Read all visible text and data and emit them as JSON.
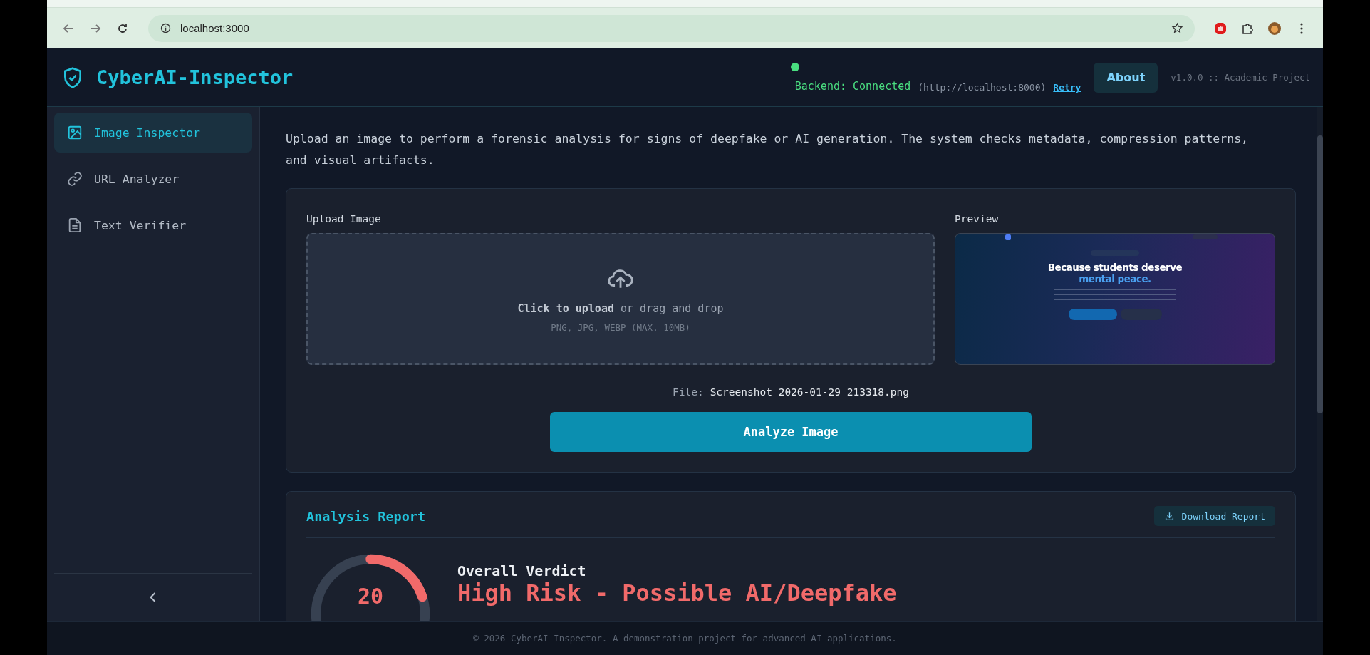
{
  "browser": {
    "address": "localhost:3000"
  },
  "app": {
    "title": "CyberAI-Inspector"
  },
  "status": {
    "label": "Backend: Connected",
    "connected": true,
    "url": "(http://localhost:8000)",
    "retry": "Retry"
  },
  "header_button": "About",
  "version": "v1.0.0 :: Academic Project",
  "sidebar": {
    "items": [
      {
        "label": "Image Inspector",
        "selected": true
      },
      {
        "label": "URL Analyzer",
        "selected": false
      },
      {
        "label": "Text Verifier",
        "selected": false
      }
    ]
  },
  "description": "Upload an image to perform a forensic analysis for signs of deepfake or AI generation. The system checks metadata, compression patterns, and visual artifacts.",
  "upload": {
    "label": "Upload Image",
    "prompt": "**Click to upload** or drag and drop",
    "hint": "PNG, JPG, WEBP (MAX. 10MB)"
  },
  "preview": {
    "label": "Preview",
    "headline": "Because students deserve",
    "highlight": "mental peace."
  },
  "file": {
    "label": "File:",
    "name": "Screenshot 2026-01-29 213318.png"
  },
  "analyze_button": "Analyze Image",
  "report": {
    "title": "Analysis Report",
    "download": "Download Report",
    "score": "20",
    "level": 0.2,
    "verdict_label": "Overall Verdict",
    "verdict": "High Risk - Possible AI/Deepfake"
  },
  "footer": "© 2026 CyberAI-Inspector. A demonstration project for advanced AI applications."
}
